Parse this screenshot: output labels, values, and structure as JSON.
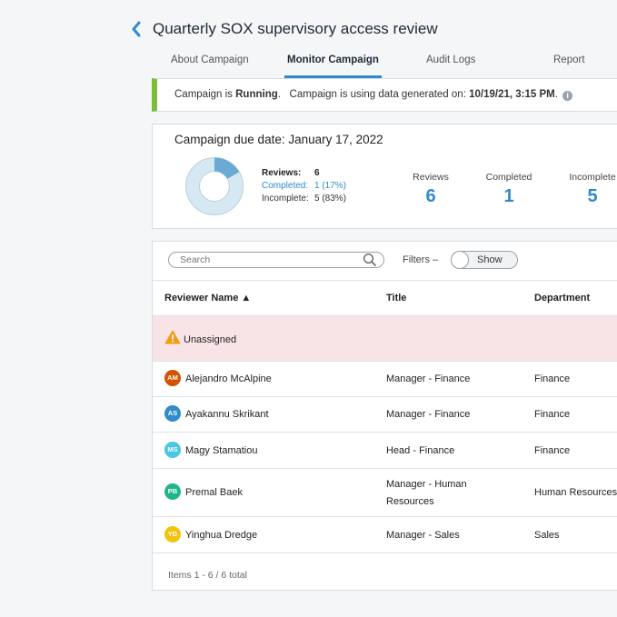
{
  "header": {
    "title": "Quarterly SOX supervisory access review"
  },
  "tabs": [
    {
      "label": "About Campaign"
    },
    {
      "label": "Monitor Campaign"
    },
    {
      "label": "Audit Logs"
    },
    {
      "label": "Report"
    }
  ],
  "banner": {
    "prefix": "Campaign is ",
    "status": "Running",
    "middle": ".   Campaign is using data generated on: ",
    "date": "10/19/21, 3:15 PM",
    "suffix": ".",
    "accent_color": "#7cbd3d"
  },
  "summary": {
    "due_date": "Campaign due date: January 17, 2022",
    "legend": {
      "reviews_label": "Reviews:",
      "reviews_value": "6",
      "completed_label": "Completed:",
      "completed_value": "1 (17%)",
      "incomplete_label": "Incomplete:",
      "incomplete_value": "5 (83%)"
    },
    "progress": {
      "completed": 1,
      "total": 6
    },
    "stats": [
      {
        "label": "Reviews",
        "value": "6"
      },
      {
        "label": "Completed",
        "value": "1"
      },
      {
        "label": "Incomplete",
        "value": "5"
      }
    ]
  },
  "toolbar": {
    "search_placeholder": "Search",
    "filters_label": "Filters  –",
    "toggle_label": "Show"
  },
  "table": {
    "columns": [
      "Reviewer Name ▲",
      "Title",
      "Department"
    ],
    "unassigned_label": "Unassigned",
    "rows": [
      {
        "initials": "AM",
        "color": "#d35400",
        "name": "Alejandro McAlpine",
        "title": "Manager - Finance",
        "title2": "",
        "department": "Finance"
      },
      {
        "initials": "AS",
        "color": "#2f8bcb",
        "name": "Ayakannu Skrikant",
        "title": "Manager - Finance",
        "title2": "",
        "department": "Finance"
      },
      {
        "initials": "MS",
        "color": "#49c6e6",
        "name": "Magy Stamatiou",
        "title": "Head - Finance",
        "title2": "",
        "department": "Finance"
      },
      {
        "initials": "PB",
        "color": "#1fb58a",
        "name": "Premal Baek",
        "title": "Manager - Human",
        "title2": "Resources",
        "department": "Human Resources"
      },
      {
        "initials": "YD",
        "color": "#f1c40f",
        "name": "Yinghua Dredge",
        "title": "Manager - Sales",
        "title2": "",
        "department": "Sales"
      }
    ],
    "footer": "Items 1 - 6 / 6 total"
  },
  "colors": {
    "accent": "#2f8bcb",
    "unassigned_bg": "#f8e4e6",
    "donut_track": "#d6e8f2",
    "donut_fill": "#6aaad5"
  }
}
